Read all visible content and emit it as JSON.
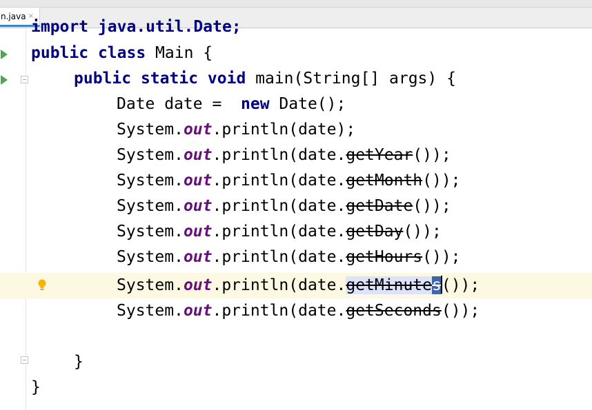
{
  "tab": {
    "label": "n.java",
    "close_glyph": "×"
  },
  "colors": {
    "keyword": "#000080",
    "static_field": "#660e7a",
    "current_line": "#fdf8e1",
    "selection": "#3f63ad",
    "run_icon": "#4ea64e"
  },
  "icons": [
    "run-class-icon",
    "run-method-icon",
    "fold-icon",
    "intention-bulb-icon"
  ],
  "code": {
    "line0": {
      "text": "import java.util.Date;"
    },
    "line1": {
      "kw1": "public",
      "kw2": "class",
      "rest": " Main {"
    },
    "line2": {
      "kw1": "public",
      "kw2": "static",
      "kw3": "void",
      "rest": " main(String[] args) {"
    },
    "line3": {
      "pre": "Date date =  ",
      "kw": "new",
      "post": " Date();"
    },
    "line4": {
      "pre": "System.",
      "field": "out",
      "post": ".println(date);"
    },
    "line5": {
      "pre": "System.",
      "field": "out",
      "mid": ".println(date.",
      "method": "getYear",
      "post": "());"
    },
    "line6": {
      "pre": "System.",
      "field": "out",
      "mid": ".println(date.",
      "method": "getMonth",
      "post": "());"
    },
    "line7": {
      "pre": "System.",
      "field": "out",
      "mid": ".println(date.",
      "method": "getDate",
      "post": "());"
    },
    "line8": {
      "pre": "System.",
      "field": "out",
      "mid": ".println(date.",
      "method": "getDay",
      "post": "());"
    },
    "line9": {
      "pre": "System.",
      "field": "out",
      "mid": ".println(date.",
      "method": "getHours",
      "post": "());"
    },
    "line10": {
      "pre": "System.",
      "field": "out",
      "mid": ".println(date.",
      "method_a": "getMinute",
      "method_b": "s",
      "post": "());"
    },
    "line11": {
      "pre": "System.",
      "field": "out",
      "mid": ".println(date.",
      "method": "getSeconds",
      "post": "());"
    },
    "line13": {
      "text": "}"
    },
    "line14": {
      "text": "}"
    }
  }
}
